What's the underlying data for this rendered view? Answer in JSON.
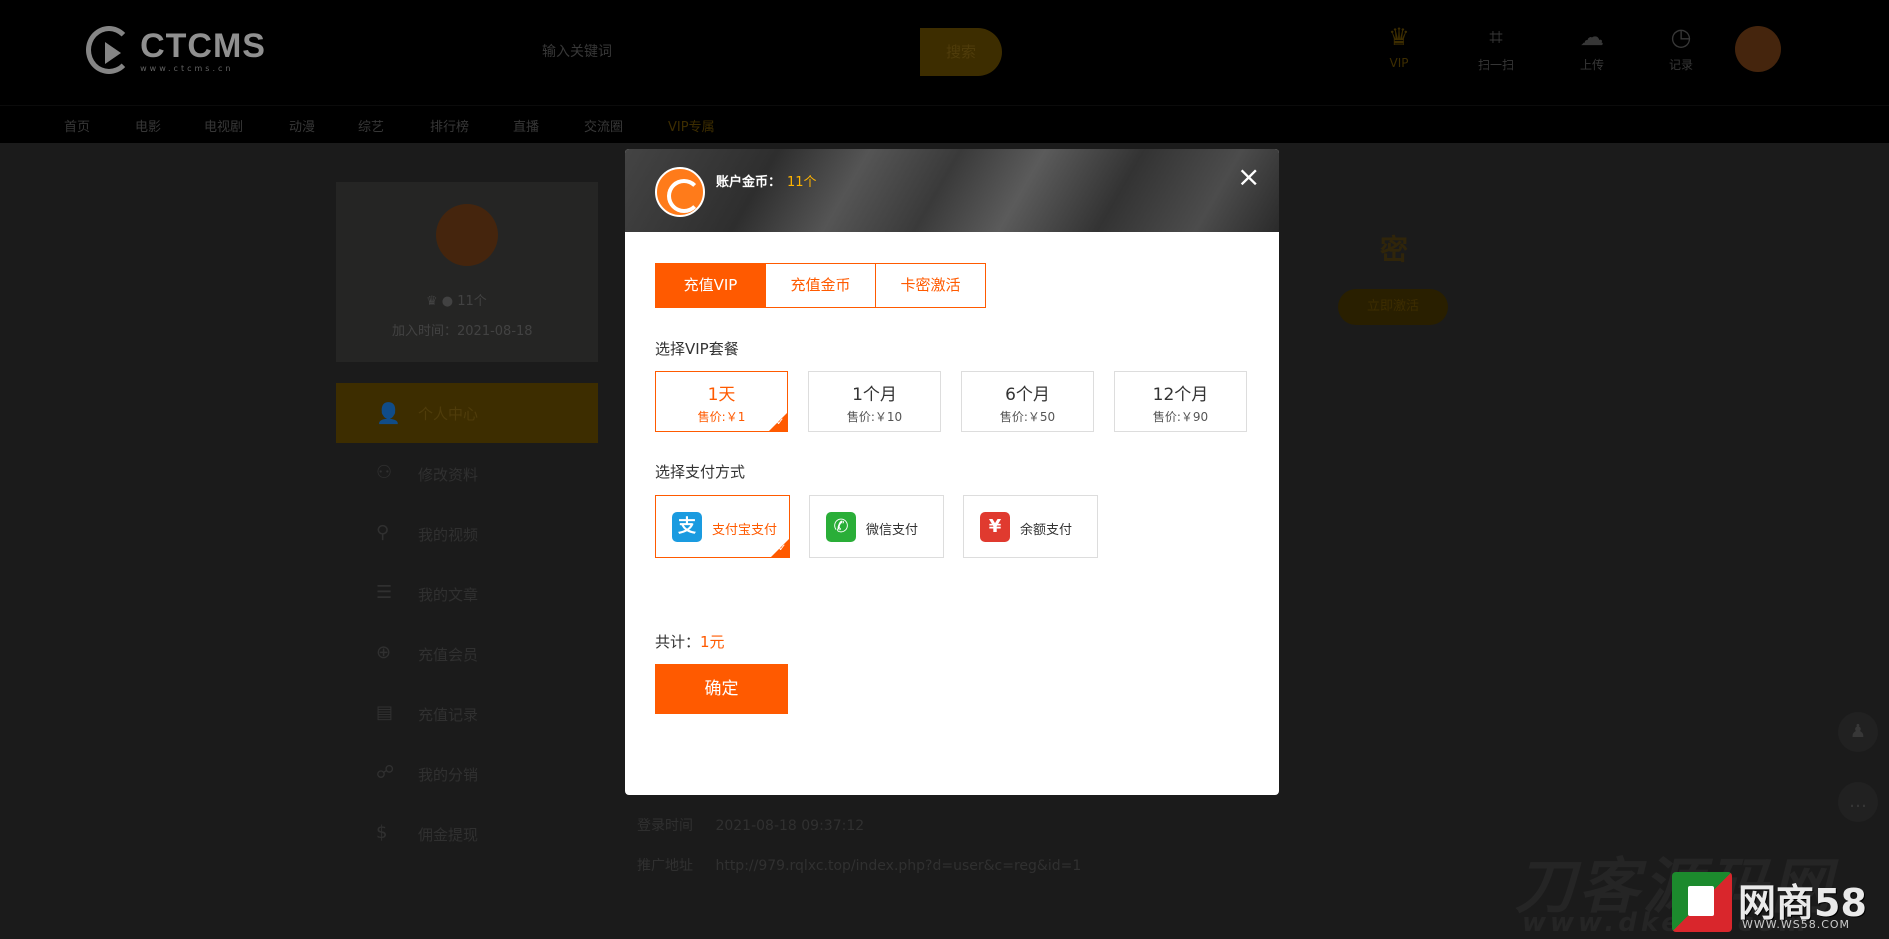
{
  "header": {
    "logo_text": "CTCMS",
    "logo_sub": "www.ctcms.cn",
    "search_placeholder": "输入关键词",
    "search_button": "搜索",
    "icons": [
      {
        "name": "vip",
        "label": "VIP",
        "glyph": "♛"
      },
      {
        "name": "scan",
        "label": "扫一扫",
        "glyph": "⌗"
      },
      {
        "name": "upload",
        "label": "上传",
        "glyph": "☁"
      },
      {
        "name": "history",
        "label": "记录",
        "glyph": "◷"
      }
    ]
  },
  "nav": {
    "items": [
      "首页",
      "电影",
      "电视剧",
      "动漫",
      "综艺",
      "排行榜",
      "直播",
      "交流圈",
      "VIP专属"
    ]
  },
  "profile": {
    "coins": "11个",
    "joined": "加入时间：2021-08-18"
  },
  "sidebar": {
    "active": "个人中心",
    "items": [
      "修改资料",
      "我的视频",
      "我的文章",
      "充值会员",
      "充值记录",
      "我的分销",
      "佣金提现"
    ]
  },
  "right_panel": {
    "title": "密",
    "button": "立即激活"
  },
  "info": {
    "login_time_label": "登录时间",
    "login_time": "2021-08-18 09:37:12",
    "promo_label": "推广地址",
    "promo_url": "http://979.rqlxc.top/index.php?d=user&c=reg&id=1"
  },
  "watermark": {
    "text": "刀客源码网",
    "url": "www.dkewl.com",
    "brand": "网商58",
    "brand_url": "WWW.WS58.COM"
  },
  "modal": {
    "balance_label": "账户金币：",
    "balance_value": "11个",
    "tabs": [
      "充值VIP",
      "充值金币",
      "卡密激活"
    ],
    "plan_label": "选择VIP套餐",
    "plans": [
      {
        "name": "1天",
        "price": "售价:￥1"
      },
      {
        "name": "1个月",
        "price": "售价:￥10"
      },
      {
        "name": "6个月",
        "price": "售价:￥50"
      },
      {
        "name": "12个月",
        "price": "售价:￥90"
      }
    ],
    "pay_label": "选择支付方式",
    "payments": [
      {
        "name": "支付宝支付",
        "glyph": "支",
        "color": "#1a9be0"
      },
      {
        "name": "微信支付",
        "glyph": "✆",
        "color": "#2aae38"
      },
      {
        "name": "余额支付",
        "glyph": "¥",
        "color": "#e03a2f"
      }
    ],
    "total_label": "共计：",
    "total_value": "1元",
    "confirm": "确定",
    "close": "×"
  }
}
